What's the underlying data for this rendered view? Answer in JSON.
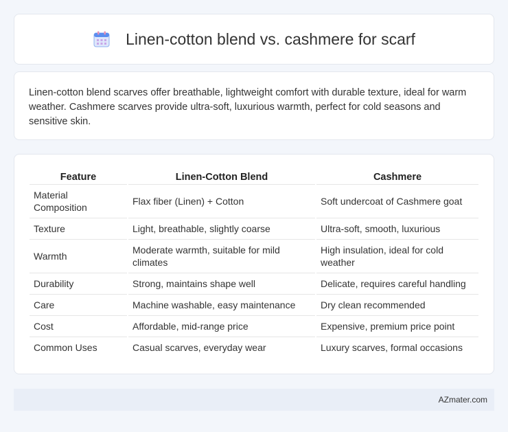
{
  "header": {
    "title": "Linen-cotton blend vs. cashmere for scarf",
    "icon": "calendar-icon"
  },
  "description": "Linen-cotton blend scarves offer breathable, lightweight comfort with durable texture, ideal for warm weather. Cashmere scarves provide ultra-soft, luxurious warmth, perfect for cold seasons and sensitive skin.",
  "table": {
    "headers": [
      "Feature",
      "Linen-Cotton Blend",
      "Cashmere"
    ],
    "rows": [
      [
        "Material Composition",
        "Flax fiber (Linen) + Cotton",
        "Soft undercoat of Cashmere goat"
      ],
      [
        "Texture",
        "Light, breathable, slightly coarse",
        "Ultra-soft, smooth, luxurious"
      ],
      [
        "Warmth",
        "Moderate warmth, suitable for mild climates",
        "High insulation, ideal for cold weather"
      ],
      [
        "Durability",
        "Strong, maintains shape well",
        "Delicate, requires careful handling"
      ],
      [
        "Care",
        "Machine washable, easy maintenance",
        "Dry clean recommended"
      ],
      [
        "Cost",
        "Affordable, mid-range price",
        "Expensive, premium price point"
      ],
      [
        "Common Uses",
        "Casual scarves, everyday wear",
        "Luxury scarves, formal occasions"
      ]
    ]
  },
  "footer": {
    "brand": "AZmater.com"
  },
  "colors": {
    "background": "#f3f6fb",
    "card": "#ffffff",
    "footer_bg": "#e9eef7",
    "icon_blue": "#5b8def",
    "icon_pink": "#e88fb3"
  }
}
